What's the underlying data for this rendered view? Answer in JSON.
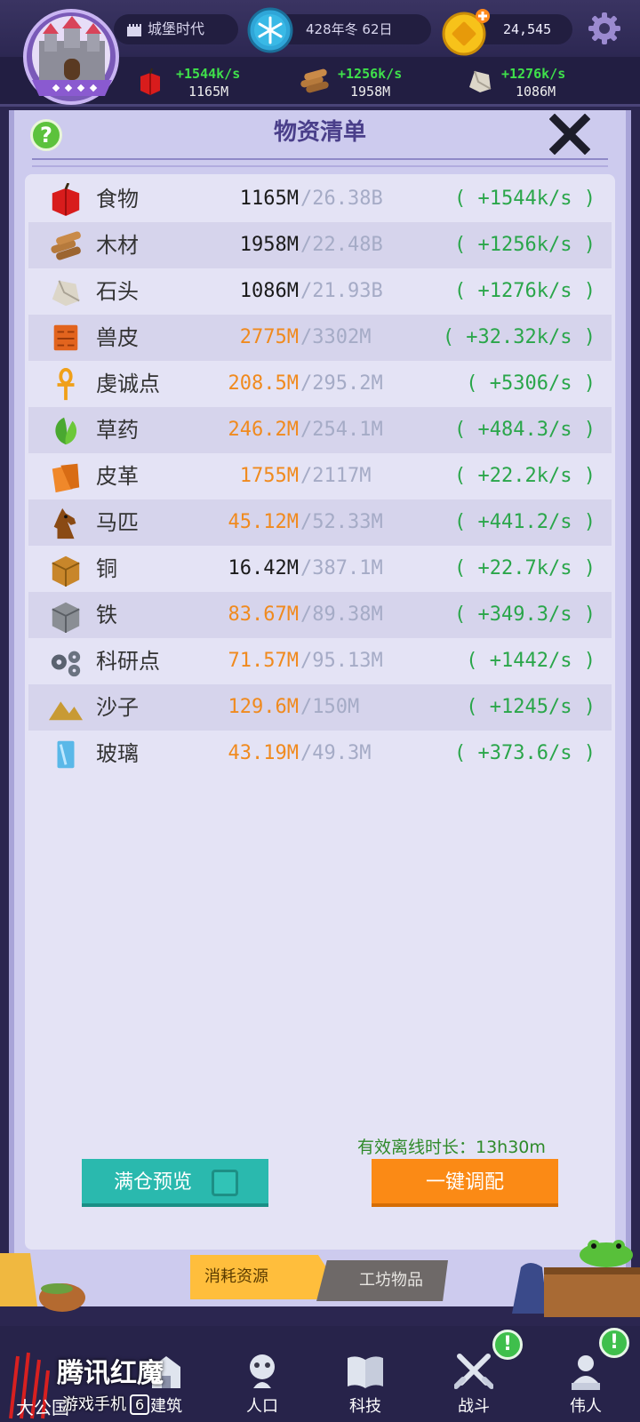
{
  "top_bar": {
    "era": "城堡时代",
    "date": "428年冬 62日",
    "gold": "24,545"
  },
  "resource_bar": [
    {
      "icon": "apple-icon",
      "rate": "+1544k/s",
      "amount": "1165M"
    },
    {
      "icon": "wood-icon",
      "rate": "+1256k/s",
      "amount": "1958M"
    },
    {
      "icon": "stone-icon",
      "rate": "+1276k/s",
      "amount": "1086M"
    }
  ],
  "panel": {
    "title": "物资清单",
    "help_label": "?"
  },
  "resources": [
    {
      "icon": "apple-icon",
      "name": "食物",
      "current": "1165M",
      "cap": "/26.38B",
      "rate": "( +1544k/s )",
      "color": "dark"
    },
    {
      "icon": "wood-icon",
      "name": "木材",
      "current": "1958M",
      "cap": "/22.48B",
      "rate": "( +1256k/s )",
      "color": "dark"
    },
    {
      "icon": "stone-icon",
      "name": "石头",
      "current": "1086M",
      "cap": "/21.93B",
      "rate": "( +1276k/s )",
      "color": "dark"
    },
    {
      "icon": "hide-icon",
      "name": "兽皮",
      "current": "2775M",
      "cap": "/3302M",
      "rate": "( +32.32k/s )",
      "color": "orange"
    },
    {
      "icon": "ankh-icon",
      "name": "虔诚点",
      "current": "208.5M",
      "cap": "/295.2M",
      "rate": "( +5306/s )",
      "color": "orange"
    },
    {
      "icon": "herb-icon",
      "name": "草药",
      "current": "246.2M",
      "cap": "/254.1M",
      "rate": "( +484.3/s )",
      "color": "orange"
    },
    {
      "icon": "leather-icon",
      "name": "皮革",
      "current": "1755M",
      "cap": "/2117M",
      "rate": "( +22.2k/s )",
      "color": "orange"
    },
    {
      "icon": "horse-icon",
      "name": "马匹",
      "current": "45.12M",
      "cap": "/52.33M",
      "rate": "( +441.2/s )",
      "color": "orange"
    },
    {
      "icon": "copper-icon",
      "name": "铜",
      "current": "16.42M",
      "cap": "/387.1M",
      "rate": "( +22.7k/s )",
      "color": "dark"
    },
    {
      "icon": "iron-icon",
      "name": "铁",
      "current": "83.67M",
      "cap": "/89.38M",
      "rate": "( +349.3/s )",
      "color": "orange"
    },
    {
      "icon": "gears-icon",
      "name": "科研点",
      "current": "71.57M",
      "cap": "/95.13M",
      "rate": "( +1442/s )",
      "color": "orange"
    },
    {
      "icon": "sand-icon",
      "name": "沙子",
      "current": "129.6M",
      "cap": "/150M",
      "rate": "( +1245/s )",
      "color": "orange"
    },
    {
      "icon": "glass-icon",
      "name": "玻璃",
      "current": "43.19M",
      "cap": "/49.3M",
      "rate": "( +373.6/s )",
      "color": "orange"
    }
  ],
  "actions": {
    "offline_label": "有效离线时长：13h30m",
    "preview_label": "满仓预览",
    "auto_label": "一键调配"
  },
  "tabs": {
    "consume": "消耗资源",
    "workshop": "工坊物品"
  },
  "nav": {
    "building": "建筑",
    "population": "人口",
    "tech": "科技",
    "battle": "战斗",
    "great": "伟人",
    "alert": "!"
  },
  "overlay": {
    "left_label": "大公国",
    "watermark_title": "腾讯红魔",
    "watermark_sub": "游戏手机",
    "watermark_num": "6"
  },
  "colors": {
    "rate_green": "#2aa64a",
    "orange": "#f08a1e",
    "teal_button": "#2ab9ae",
    "orange_button": "#fb8a15"
  }
}
